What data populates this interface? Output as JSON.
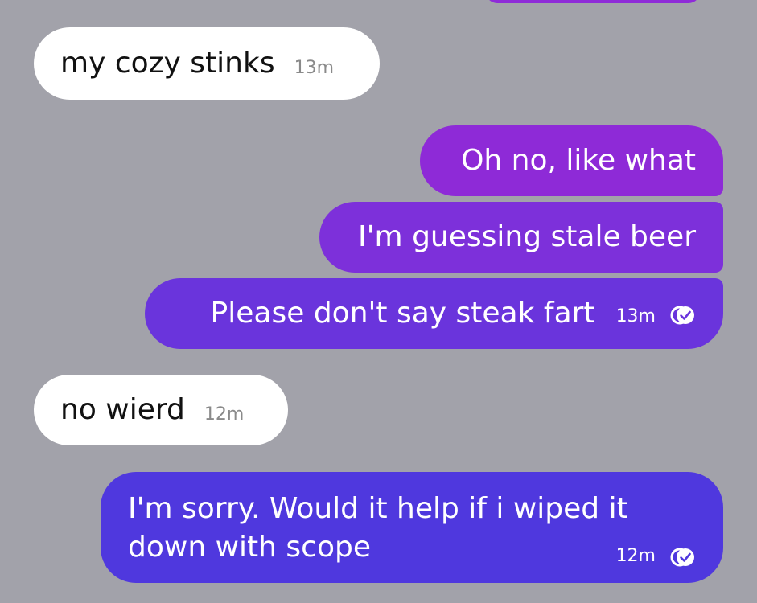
{
  "colors": {
    "background": "#a2a2aa",
    "incoming_bubble": "#ffffff",
    "outgoing_bubble_1": "#8e2ad7",
    "outgoing_bubble_2": "#7d30da",
    "outgoing_bubble_3": "#6a34dc",
    "outgoing_bubble_4": "#4f38de",
    "read_icon": "#ffffff"
  },
  "messages": [
    {
      "direction": "incoming",
      "text": "my cozy stinks",
      "time": "13m"
    },
    {
      "direction": "outgoing",
      "text": "Oh no, like what"
    },
    {
      "direction": "outgoing",
      "text": "I'm guessing stale beer"
    },
    {
      "direction": "outgoing",
      "text": "Please don't say steak fart",
      "time": "13m",
      "status_icon": "read-receipt-icon"
    },
    {
      "direction": "incoming",
      "text": "no wierd",
      "time": "12m"
    },
    {
      "direction": "outgoing",
      "text": "I'm sorry. Would it help if i wiped it\ndown with scope",
      "time": "12m",
      "status_icon": "read-receipt-icon"
    }
  ]
}
